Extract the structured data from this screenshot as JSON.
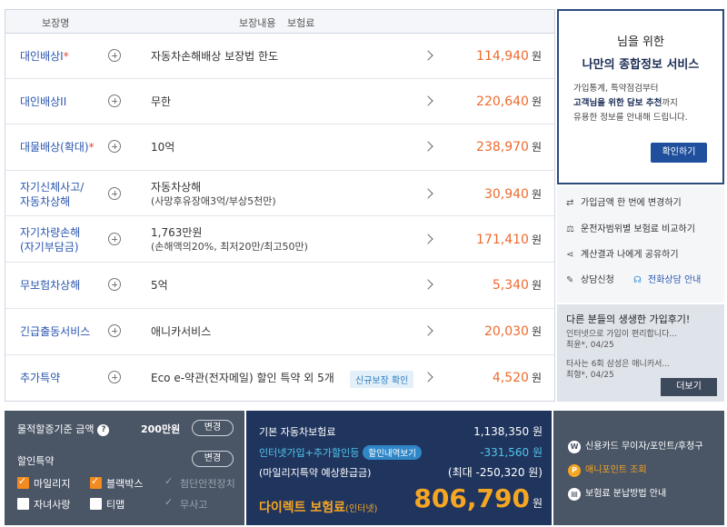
{
  "table": {
    "headers": {
      "name": "보장명",
      "content": "보장내용",
      "premium": "보험료"
    },
    "currency": "원",
    "rows": [
      {
        "name": "대인배상I",
        "star": "*",
        "content": "자동차손해배상 보장법 한도",
        "sub": "",
        "premium": "114,940",
        "badge": ""
      },
      {
        "name": "대인배상II",
        "star": "",
        "content": "무한",
        "sub": "",
        "premium": "220,640",
        "badge": ""
      },
      {
        "name": "대물배상(확대)",
        "star": "*",
        "content": "10억",
        "sub": "",
        "premium": "238,970",
        "badge": ""
      },
      {
        "name": "자기신체사고/",
        "name2": "자동차상해",
        "star": "",
        "content": "자동차상해",
        "sub": "(사망후유장애3억/부상5천만)",
        "premium": "30,940",
        "badge": ""
      },
      {
        "name": "자기차량손해",
        "name2": "(자기부담금)",
        "star": "",
        "content": "1,763만원",
        "sub": "(손해액의20%, 최저20만/최고50만)",
        "premium": "171,410",
        "badge": ""
      },
      {
        "name": "무보험차상해",
        "star": "",
        "content": "5억",
        "sub": "",
        "premium": "5,340",
        "badge": ""
      },
      {
        "name": "긴급출동서비스",
        "star": "",
        "content": "애니카서비스",
        "sub": "",
        "premium": "20,030",
        "badge": ""
      },
      {
        "name": "추가특약",
        "star": "",
        "content": "Eco e-약관(전자메일) 할인 특약 외 5개",
        "sub": "",
        "premium": "4,520",
        "badge": "신규보장 확인"
      }
    ]
  },
  "info_panel": {
    "title1": "님을 위한",
    "title2": "나만의 종합정보 서비스",
    "desc1": "가입통계, 특약점검부터",
    "desc2_bold": "고객님을 위한 담보 추천",
    "desc2_rest": "까지",
    "desc3": "유용한 정보를 안내해 드립니다.",
    "button": "확인하기"
  },
  "actions": [
    {
      "icon": "shuffle-icon",
      "glyph": "⇄",
      "label": "가입금액 한 번에 변경하기"
    },
    {
      "icon": "scale-icon",
      "glyph": "⚖",
      "label": "운전자범위별 보험료 비교하기"
    },
    {
      "icon": "share-icon",
      "glyph": "⋖",
      "label": "계산결과 나에게 공유하기"
    }
  ],
  "consult": {
    "apply": "상담신청",
    "phone": "전화상담 안내"
  },
  "reviews": {
    "title": "다른 분들의 생생한 가입후기!",
    "items": [
      {
        "text": "인터넷으로 가입이 편리합니다...",
        "meta": "최윤*, 04/25"
      },
      {
        "text": "타사는 6회 삼성은 애니카서...",
        "meta": "최형*, 04/25"
      }
    ],
    "more": "더보기"
  },
  "bottom_left": {
    "property_label": "물적할증기준 금액",
    "property_value": "200만원",
    "change": "변경",
    "discount_label": "할인특약",
    "options": [
      {
        "label": "마일리지",
        "state": "checked"
      },
      {
        "label": "블랙박스",
        "state": "checked"
      },
      {
        "label": "첨단안전장치",
        "state": "disabled"
      },
      {
        "label": "자녀사랑",
        "state": "unchecked"
      },
      {
        "label": "티맵",
        "state": "unchecked"
      },
      {
        "label": "무사고",
        "state": "disabled"
      }
    ]
  },
  "bottom_mid": {
    "base_label": "기본 자동차보험료",
    "base_value": "1,138,350 원",
    "disc_label": "인터넷가입+추가할인등",
    "disc_pill": "할인내역보기",
    "disc_value": "-331,560 원",
    "mileage_label": "(마일리지특약 예상환급금)",
    "mileage_value": "(최대 -250,320 원)",
    "direct_label": "다이렉트 보험료",
    "direct_suffix": "(인터넷)",
    "direct_value": "806,790",
    "won": "원"
  },
  "bottom_right": [
    {
      "badge": "W",
      "label": "신용카드 무이자/포인트/후청구"
    },
    {
      "badge": "P",
      "label": "애니포인트 조회"
    },
    {
      "badge": "▤",
      "label": "보험료 분납방법 안내"
    }
  ],
  "colors": {
    "accent_orange": "#ee6a2e",
    "link_blue": "#2a56b0",
    "navy": "#20355e",
    "slate": "#4a5566"
  }
}
